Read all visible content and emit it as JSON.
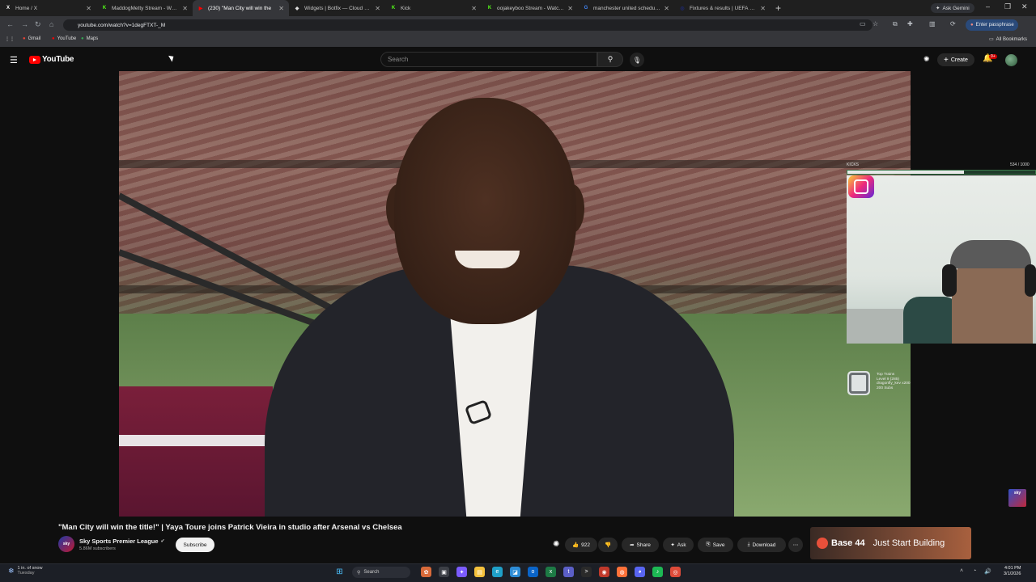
{
  "browser": {
    "tabs": [
      {
        "title": "Home / X",
        "icon": "x-logo-icon",
        "color": "#ffffff",
        "glyph": "X"
      },
      {
        "title": "MaddogMetty Stream - Watch",
        "icon": "kick-icon",
        "color": "#53fc18",
        "glyph": "K"
      },
      {
        "title": "(230) \"Man City will win the",
        "icon": "youtube-icon",
        "color": "#ff0000",
        "glyph": "▶",
        "active": true
      },
      {
        "title": "Widgets | Botfix — Cloud Stre",
        "icon": "botfix-icon",
        "color": "#dddddd",
        "glyph": "◆"
      },
      {
        "title": "Kick",
        "icon": "kick-icon",
        "color": "#53fc18",
        "glyph": "K"
      },
      {
        "title": "oojakeyboo Stream - Watch Li",
        "icon": "kick-icon",
        "color": "#53fc18",
        "glyph": "K"
      },
      {
        "title": "manchester united schedule - G",
        "icon": "google-icon",
        "color": "#4285f4",
        "glyph": "G"
      },
      {
        "title": "Fixtures & results | UEFA Cham",
        "icon": "uefa-icon",
        "color": "#1e2a78",
        "glyph": "◎"
      }
    ],
    "ask_gemini": "Ask Gemini",
    "url": "youtube.com/watch?v=1degFTXT-_M",
    "passphrase_label": "Enter passphrase",
    "bookmarks": [
      {
        "label": "Gmail",
        "icon": "gmail-icon",
        "color": "#ea4335"
      },
      {
        "label": "YouTube",
        "icon": "youtube-icon",
        "color": "#ff0000"
      },
      {
        "label": "Maps",
        "icon": "maps-icon",
        "color": "#34a853"
      }
    ],
    "all_bookmarks": "All Bookmarks"
  },
  "youtube": {
    "logo_text": "YouTube",
    "search_placeholder": "Search",
    "create_label": "Create",
    "notif_count": "9+"
  },
  "overlay": {
    "kicks_label": "KICKS",
    "kicks_count": "534 / 1000",
    "kicks_progress": 0.534,
    "train_lines": [
      "Top Trains",
      "Level 9 (285)",
      "dragonfly_kev x200",
      "200 Subs"
    ],
    "sky_logo": "sky"
  },
  "video": {
    "title": "\"Man City will win the title!\" | Yaya Toure joins Patrick Vieira in studio after Arsenal vs Chelsea",
    "channel": "Sky Sports Premier League",
    "channel_avatar_text": "sky",
    "subscribers": "5.86M subscribers",
    "subscribe_label": "Subscribe",
    "likes": "922",
    "share_label": "Share",
    "ask_label": "Ask",
    "save_label": "Save",
    "download_label": "Download"
  },
  "ad": {
    "brand": "Base 44",
    "tagline": "Just Start Building"
  },
  "taskbar": {
    "weather_line1": "1 in. of snow",
    "weather_line2": "Tuesday",
    "search_label": "Search",
    "time": "4:01 PM",
    "date": "3/1/2026"
  }
}
